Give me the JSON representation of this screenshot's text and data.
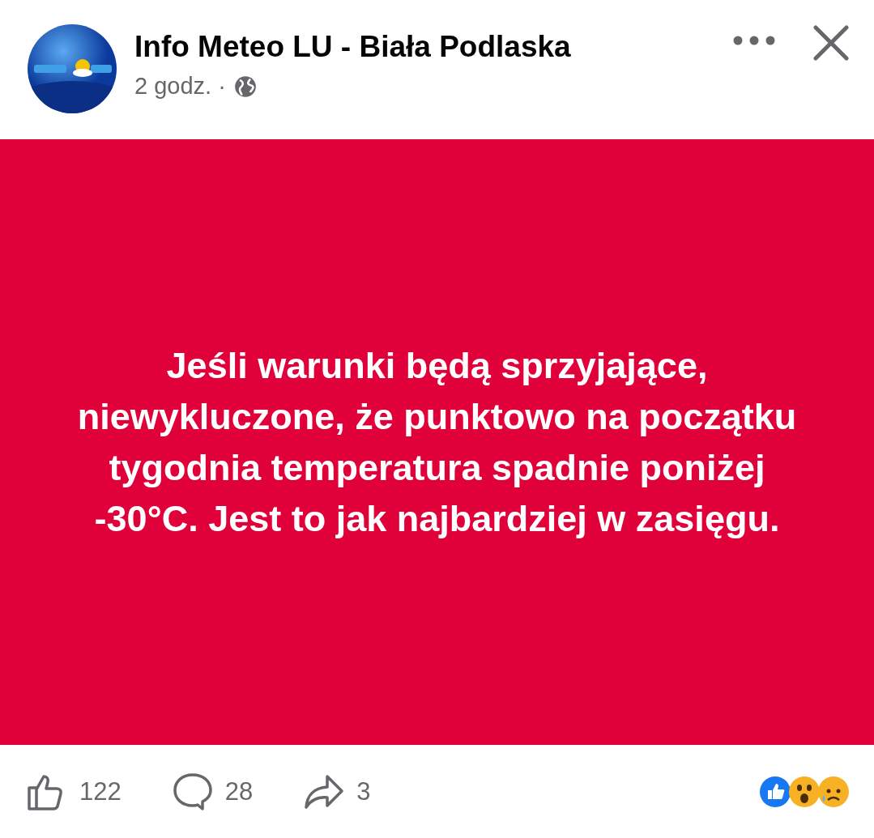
{
  "post": {
    "author": "Info Meteo LU - Biała Podlaska",
    "time": "2 godz.",
    "separator": "·",
    "text": "Jeśli warunki będą sprzyjające, niewykluczone, że punktowo na początku tygodnia temperatura spadnie poniżej -30°C. Jest to jak najbardziej w zasięgu."
  },
  "actions": [
    {
      "kind": "like",
      "count": "122"
    },
    {
      "kind": "comment",
      "count": "28"
    },
    {
      "kind": "share",
      "count": "3"
    }
  ],
  "reactions": [
    {
      "kind": "like"
    },
    {
      "kind": "wow"
    },
    {
      "kind": "sad"
    }
  ]
}
